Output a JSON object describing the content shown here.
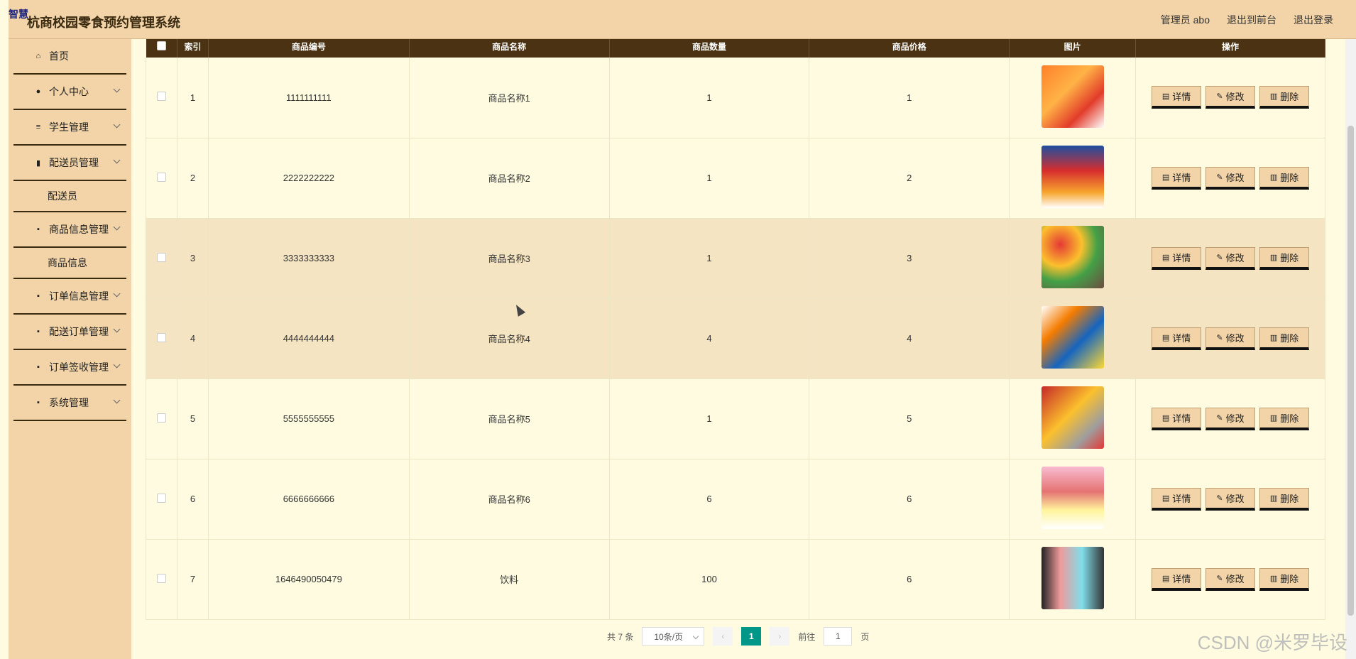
{
  "header": {
    "logo_text": "智慧",
    "title": "杭商校园零食预约管理系统",
    "admin": "管理员 abo",
    "front": "退出到前台",
    "logout": "退出登录"
  },
  "sidebar": {
    "home": "首页",
    "personal": "个人中心",
    "student": "学生管理",
    "courier_mgmt": "配送员管理",
    "courier": "配送员",
    "goods_mgmt": "商品信息管理",
    "goods": "商品信息",
    "order_mgmt": "订单信息管理",
    "delivery_order": "配送订单管理",
    "sign_mgmt": "订单签收管理",
    "system": "系统管理"
  },
  "table": {
    "headers": [
      "索引",
      "商品编号",
      "商品名称",
      "商品数量",
      "商品价格",
      "图片",
      "操作"
    ],
    "rows": [
      {
        "idx": "1",
        "code": "1111111111",
        "name": "商品名称1",
        "qty": "1",
        "price": "1"
      },
      {
        "idx": "2",
        "code": "2222222222",
        "name": "商品名称2",
        "qty": "1",
        "price": "2"
      },
      {
        "idx": "3",
        "code": "3333333333",
        "name": "商品名称3",
        "qty": "1",
        "price": "3"
      },
      {
        "idx": "4",
        "code": "4444444444",
        "name": "商品名称4",
        "qty": "4",
        "price": "4"
      },
      {
        "idx": "5",
        "code": "5555555555",
        "name": "商品名称5",
        "qty": "1",
        "price": "5"
      },
      {
        "idx": "6",
        "code": "6666666666",
        "name": "商品名称6",
        "qty": "6",
        "price": "6"
      },
      {
        "idx": "7",
        "code": "1646490050479",
        "name": "饮料",
        "qty": "100",
        "price": "6"
      }
    ],
    "actions": {
      "detail": "详情",
      "edit": "修改",
      "delete": "删除"
    }
  },
  "pager": {
    "total": "共 7 条",
    "size": "10条/页",
    "current": "1",
    "goto_prefix": "前往",
    "goto_value": "1",
    "goto_suffix": "页"
  },
  "watermark": "CSDN @米罗毕设",
  "colors": {
    "header_bg": "#f2d4a8",
    "table_head": "#4a3212",
    "content_bg": "#fefbe0",
    "accent": "#009688"
  }
}
